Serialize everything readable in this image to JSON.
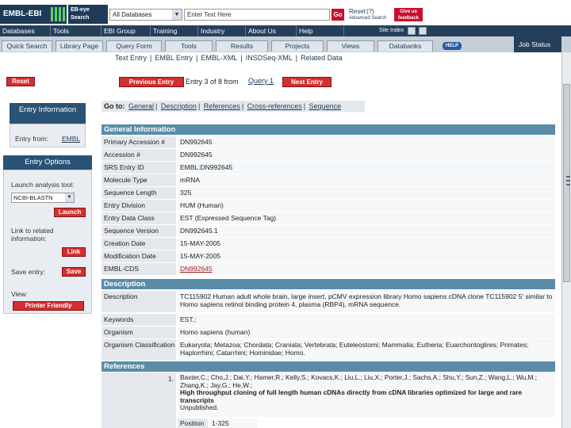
{
  "header": {
    "logo": "EMBL-EBI",
    "ebeye": "EB-eye Search",
    "db_select": "All Databases",
    "search_placeholder": "Enter Text Here",
    "go": "Go",
    "reset": "Reset",
    "help_q": "(?)",
    "advanced": "Advanced Search",
    "feedback": "Give us feedback"
  },
  "nav1": {
    "items": [
      "Databases",
      "Tools",
      "EBI Group",
      "Training",
      "Industry",
      "About Us",
      "Help"
    ],
    "site_index": "Site Index"
  },
  "nav2": {
    "tabs": [
      "Quick Search",
      "Library Page",
      "Query Form",
      "Tools",
      "Results",
      "Projects",
      "Views",
      "Databanks"
    ],
    "help": "HELP",
    "job_status": "Job Status"
  },
  "sublinks": [
    "Text Entry",
    "EMBL Entry",
    "EMBL-XML",
    "INSDSeq-XML",
    "Related Data"
  ],
  "entry_nav": {
    "reset": "Reset",
    "prev": "Previous Entry",
    "entry_of": "Entry 3 of 8 from",
    "query_link": "Query 1",
    "next": "Next Entry"
  },
  "left": {
    "entry_info_title": "Entry Information",
    "entry_from_label": "Entry from:",
    "entry_from_link": "EMBL",
    "entry_options_title": "Entry Options",
    "launch_label": "Launch analysis tool:",
    "launch_select": "NCBI-BLASTN",
    "launch_btn": "Launch",
    "link_label": "Link to related information:",
    "link_btn": "Link",
    "save_label": "Save entry:",
    "save_btn": "Save",
    "view_label": "View:",
    "printer_btn": "Printer Friendly"
  },
  "goto": {
    "label": "Go to:",
    "links": [
      "General",
      "Description",
      "References",
      "Cross-references",
      "Sequence"
    ]
  },
  "general": {
    "title": "General Information",
    "rows": [
      {
        "k": "Primary Accession #",
        "v": "DN992645"
      },
      {
        "k": "Accession #",
        "v": "DN992645"
      },
      {
        "k": "SRS Entry ID",
        "v": "EMBL:DN992645"
      },
      {
        "k": "Molecule Type",
        "v": "mRNA"
      },
      {
        "k": "Sequence Length",
        "v": "325"
      },
      {
        "k": "Entry Division",
        "v": "HUM (Human)"
      },
      {
        "k": "Entry Data Class",
        "v": "EST (Expressed Sequence Tag)"
      },
      {
        "k": "Sequence Version",
        "v": "DN992645.1"
      },
      {
        "k": "Creation Date",
        "v": "15-MAY-2005"
      },
      {
        "k": "Modification Date",
        "v": "15-MAY-2005"
      },
      {
        "k": "EMBL-CDS",
        "v": "DN992645"
      }
    ]
  },
  "description": {
    "title": "Description",
    "desc_k": "Description",
    "desc_v": "TC115902 Human adult whole brain, large insert, pCMV expression library Homo sapiens cDNA clone TC115902 5' similar to Homo sapiens retinol binding protein 4, plasma (RBP4), mRNA sequence.",
    "kw_k": "Keywords",
    "kw_v": "EST.;",
    "org_k": "Organism",
    "org_v": "Homo sapiens (human)",
    "cls_k": "Organism Classification",
    "cls_v": "Eukaryota; Metazoa; Chordata; Craniata; Vertebrata; Euteleostomi; Mammalia; Eutheria; Euarchontoglires; Primates; Haplorrhini; Catarrhini; Hominidae; Homo."
  },
  "references": {
    "title": "References",
    "num": "1.",
    "authors": "Baxter,C.; Cho,J.; Dai,Y.; Hamer,R.; Kelly,S.; Kovacs,K.; Liu,L.; Liu,X.; Porter,J.; Sachs,A.; Shu,Y.; Sun,Z.; Wang,L.; Wu,M.; Zhang,K.; Jay,G.; He,W.;",
    "title_text": "High throughput cloning of full length human cDNAs directly from cDNA libraries optimized for large and rare transcripts",
    "status": "Unpublished.",
    "pos_k": "Position",
    "pos_v": "1-325"
  }
}
